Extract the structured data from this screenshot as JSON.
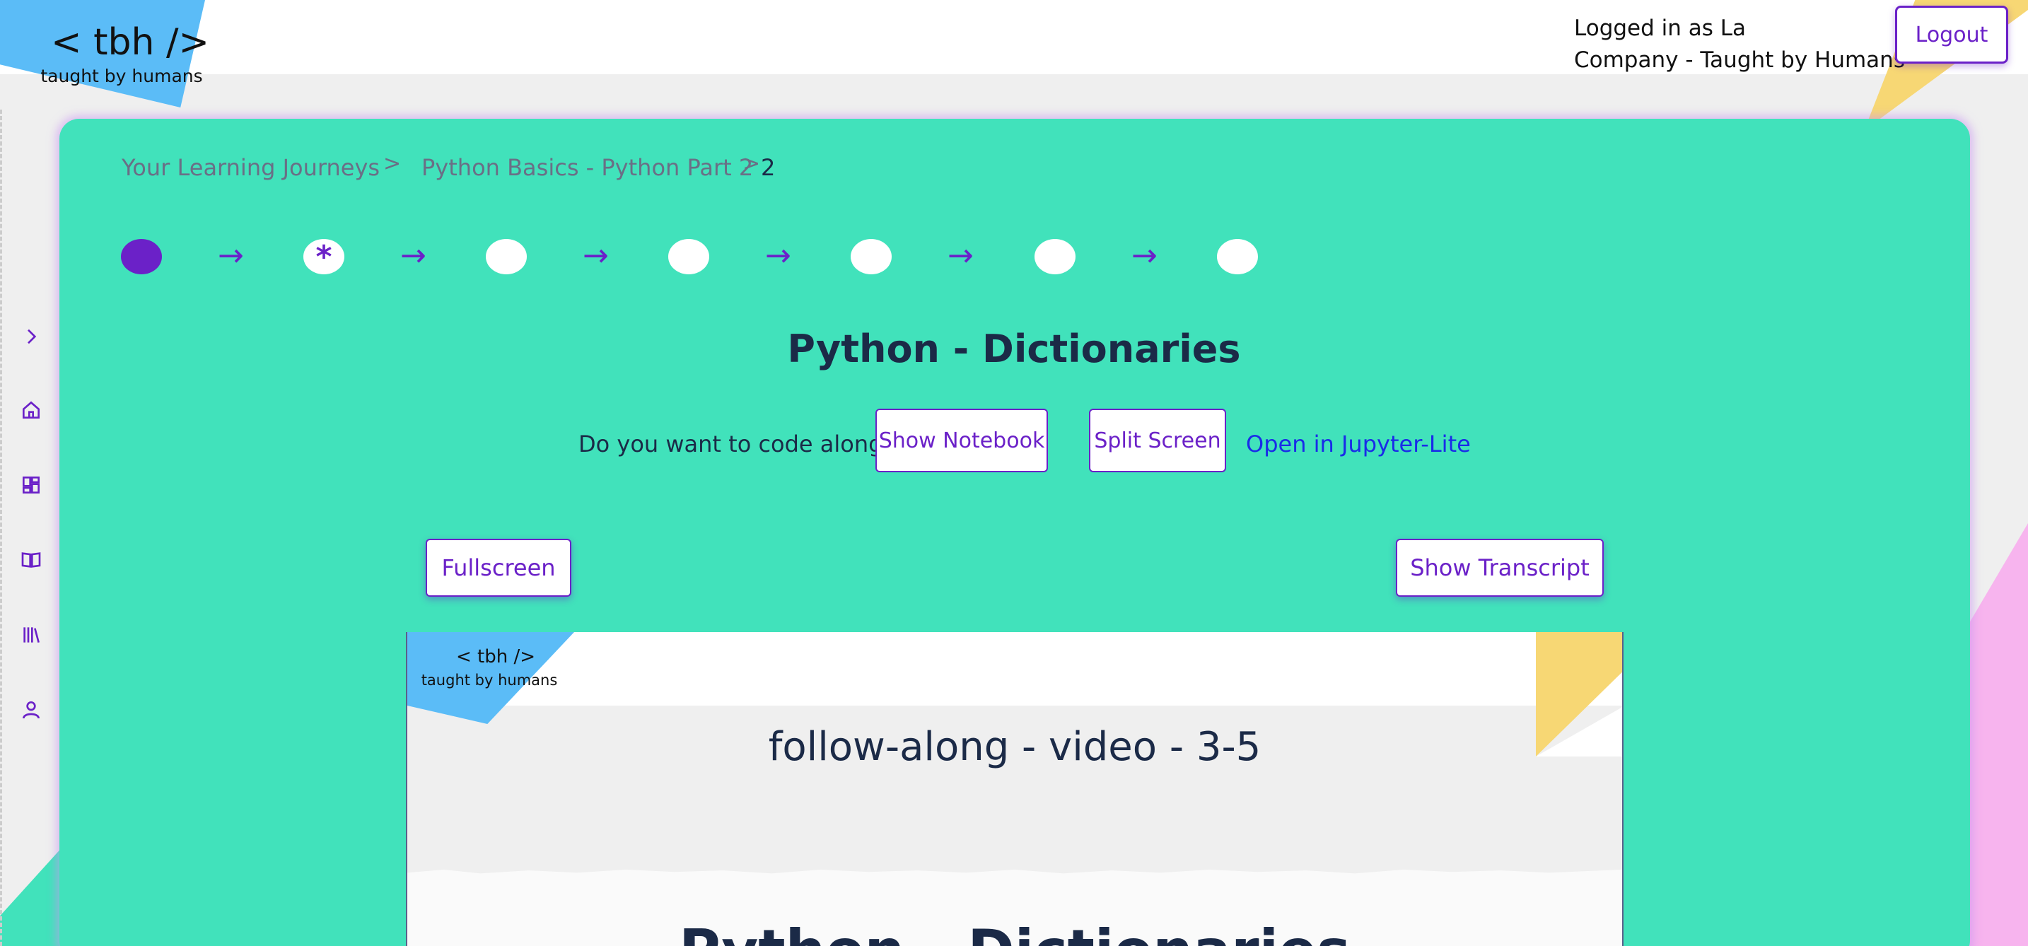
{
  "header": {
    "logo_main": "< tbh />",
    "logo_sub": "taught by humans",
    "user_line1": "Logged in as La",
    "user_line2": "Company - Taught by Humans",
    "logout_label": "Logout"
  },
  "sidebar": {
    "items": [
      {
        "icon": "chevron-right-icon"
      },
      {
        "icon": "home-icon"
      },
      {
        "icon": "dashboard-icon"
      },
      {
        "icon": "book-open-icon"
      },
      {
        "icon": "library-icon"
      },
      {
        "icon": "user-icon"
      }
    ]
  },
  "breadcrumb": {
    "items": [
      "Your Learning Journeys",
      "Python Basics - Python Part 2",
      "2"
    ],
    "separator": ">"
  },
  "progress": {
    "steps": [
      "done",
      "current",
      "todo",
      "todo",
      "todo",
      "todo",
      "todo"
    ],
    "current_marker": "*",
    "arrow": "→"
  },
  "lesson": {
    "title": "Python - Dictionaries",
    "code_along_prompt": "Do you want to code along?",
    "show_notebook_label": "Show Notebook",
    "split_screen_label": "Split Screen",
    "jupyter_link_label": "Open in Jupyter-Lite",
    "fullscreen_label": "Fullscreen",
    "show_transcript_label": "Show Transcript"
  },
  "video": {
    "logo_main": "< tbh />",
    "logo_sub": "taught by humans",
    "heading": "follow-along - video - 3-5",
    "peek_text": "Python - Dictionaries"
  },
  "colors": {
    "accent": "#6b21c8",
    "card_green": "#41e2bb",
    "logo_blue": "#5bbcf7",
    "deco_yellow": "#f7d774",
    "deco_pink": "#f7b4ee",
    "link_blue": "#1a2be8"
  }
}
